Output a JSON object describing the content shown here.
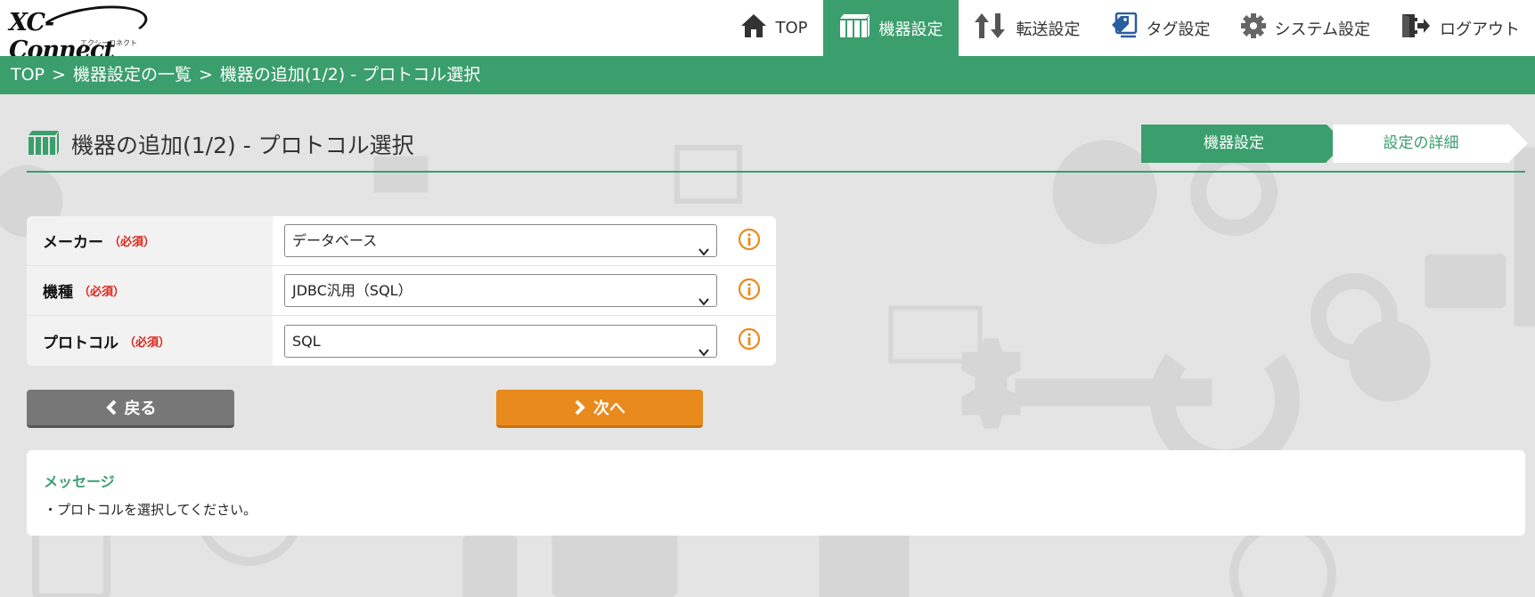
{
  "header": {
    "logo_text": "XC-Connect",
    "logo_subtext": "エクシーコネクト",
    "nav": [
      {
        "label": "TOP",
        "icon": "home-icon"
      },
      {
        "label": "機器設定",
        "icon": "device-icon",
        "active": true
      },
      {
        "label": "転送設定",
        "icon": "transfer-icon"
      },
      {
        "label": "タグ設定",
        "icon": "tag-icon"
      },
      {
        "label": "システム設定",
        "icon": "gear-icon"
      },
      {
        "label": "ログアウト",
        "icon": "logout-icon"
      }
    ]
  },
  "breadcrumb": {
    "items": [
      "TOP",
      "機器設定の一覧",
      "機器の追加(1/2) - プロトコル選択"
    ],
    "separator": ">"
  },
  "page": {
    "title": "機器の追加(1/2) - プロトコル選択",
    "steps": [
      "機器設定",
      "設定の詳細"
    ]
  },
  "form": {
    "required_label": "（必須）",
    "rows": [
      {
        "label": "メーカー",
        "value": "データベース"
      },
      {
        "label": "機種",
        "value": "JDBC汎用（SQL）"
      },
      {
        "label": "プロトコル",
        "value": "SQL"
      }
    ]
  },
  "buttons": {
    "back": "戻る",
    "next": "次へ"
  },
  "message": {
    "title": "メッセージ",
    "text": "・プロトコルを選択してください。"
  },
  "colors": {
    "accent": "#3b9e6d",
    "orange": "#e98a1d",
    "required": "#d9261c",
    "back_button": "#777777",
    "background": "#e4e4e4"
  }
}
